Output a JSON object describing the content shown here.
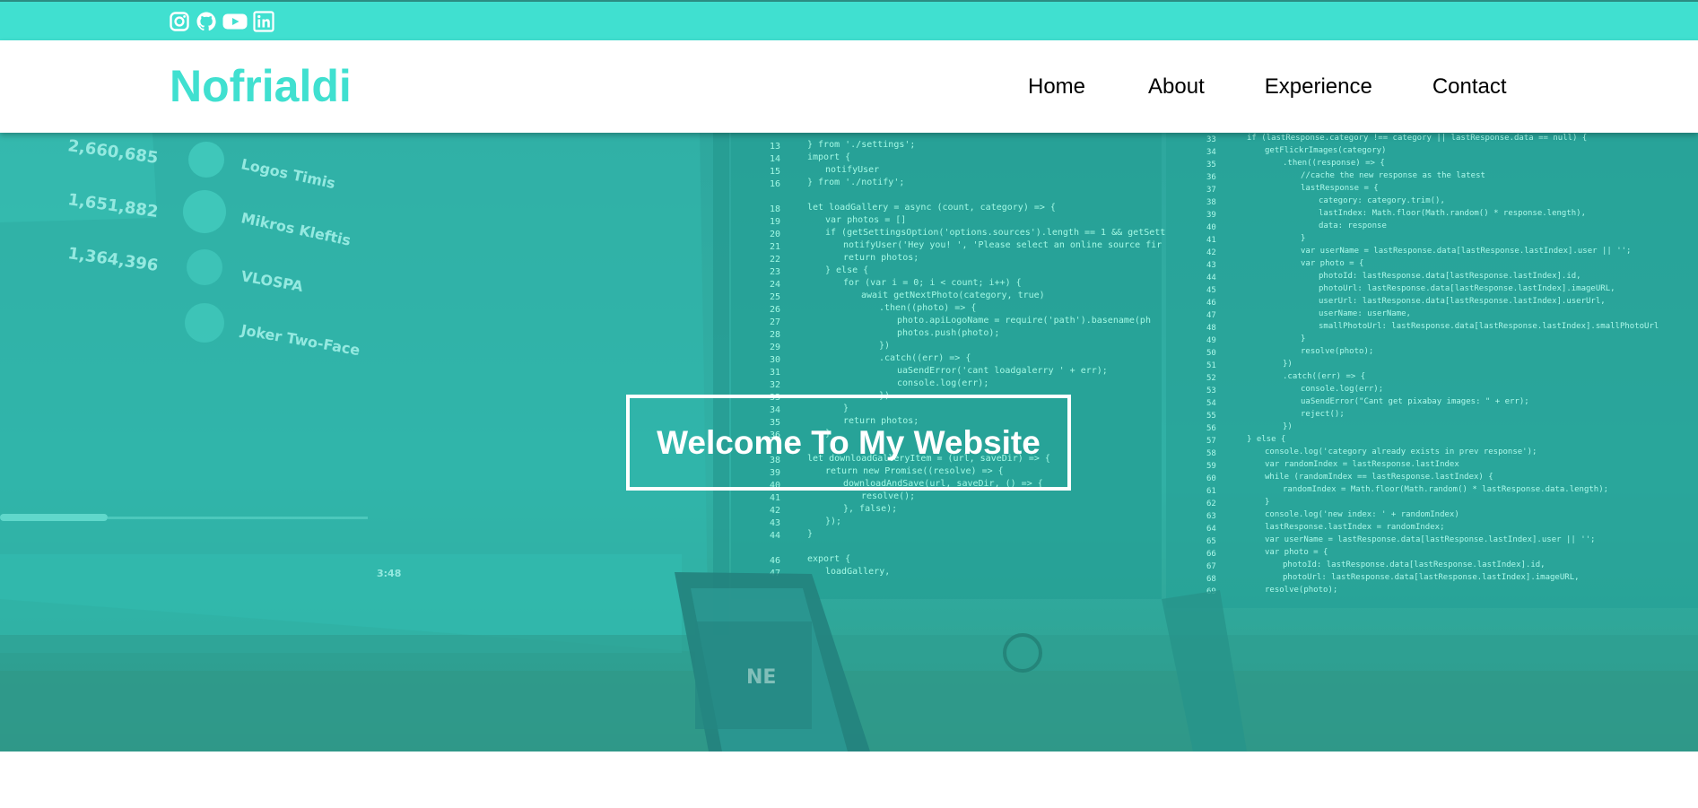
{
  "social": {
    "icons": [
      "instagram-icon",
      "github-icon",
      "youtube-icon",
      "linkedin-icon"
    ]
  },
  "navbar": {
    "brand": "Nofrialdi",
    "links": [
      "Home",
      "About",
      "Experience",
      "Contact"
    ]
  },
  "hero": {
    "heading": "Welcome To My Website"
  },
  "colors": {
    "accent": "#40e0d0",
    "text": "#000000",
    "hero_overlay": "#2aa196"
  }
}
